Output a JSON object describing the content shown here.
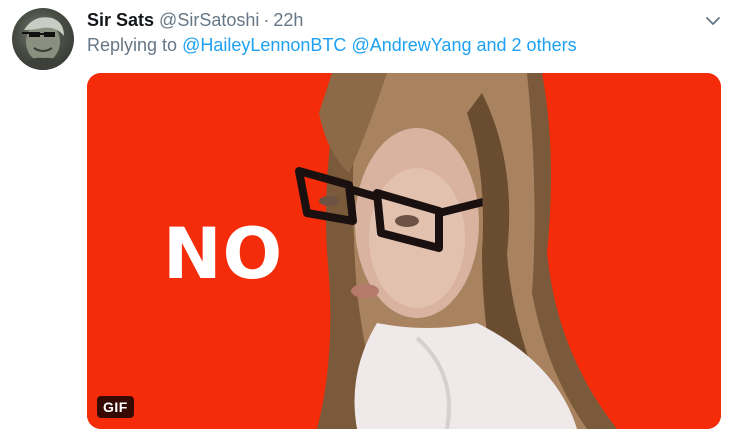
{
  "tweet": {
    "avatar_icon": "profile-avatar",
    "display_name": "Sir Sats",
    "handle": "@SirSatoshi",
    "separator": "·",
    "time": "22h",
    "caret_icon": "chevron-down-icon"
  },
  "reply": {
    "prefix": "Replying to",
    "mentions": [
      "@HaileyLennonBTC",
      "@AndrewYang"
    ],
    "conjunction": "and",
    "others": "2 others"
  },
  "media": {
    "overlay_text": "NO",
    "badge": "GIF",
    "background_color": "#f42c0a"
  },
  "colors": {
    "name": "#14171a",
    "muted": "#657786",
    "link": "#1da1f2"
  }
}
